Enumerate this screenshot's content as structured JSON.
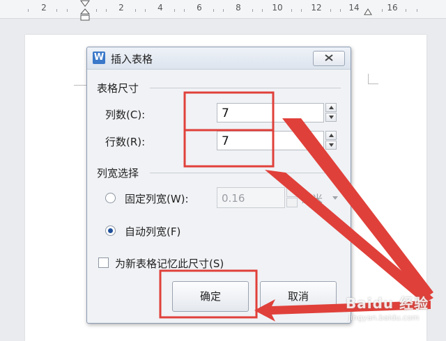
{
  "ruler": {
    "numbers": [
      "2",
      "2",
      "4",
      "6",
      "8",
      "10",
      "12",
      "14",
      "16"
    ]
  },
  "dialog": {
    "title": "插入表格",
    "app_icon_letter": "W",
    "table_size_group": "表格尺寸",
    "columns_label": "列数(C):",
    "columns_value": "7",
    "rows_label": "行数(R):",
    "rows_value": "7",
    "col_width_group": "列宽选择",
    "fixed_width_label": "固定列宽(W):",
    "fixed_width_value": "0.16",
    "fixed_width_unit": "厘米",
    "auto_width_label": "自动列宽(F)",
    "remember_label": "为新表格记忆此尺寸(S)",
    "ok_label": "确定",
    "cancel_label": "取消"
  },
  "annotation": {
    "highlight_color": "#e0403a",
    "watermark_text": "Baidu 经验",
    "watermark_url": "jingyan.baidu.com"
  }
}
